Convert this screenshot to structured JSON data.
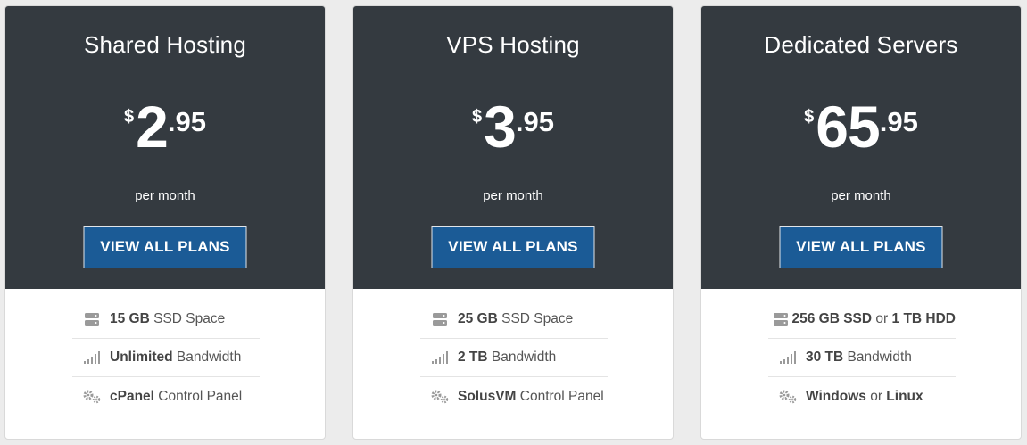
{
  "cards": [
    {
      "title": "Shared Hosting",
      "currency": "$",
      "price_whole": "2",
      "price_cents": ".95",
      "period": "per month",
      "button_label": "VIEW ALL PLANS",
      "features": [
        {
          "icon": "server-icon",
          "bold": "15 GB",
          "rest": " SSD Space",
          "bold2": "",
          "rest2": ""
        },
        {
          "icon": "signal-bars-icon",
          "bold": "Unlimited",
          "rest": " Bandwidth",
          "bold2": "",
          "rest2": ""
        },
        {
          "icon": "gears-icon",
          "bold": "cPanel",
          "rest": " Control Panel",
          "bold2": "",
          "rest2": ""
        }
      ]
    },
    {
      "title": "VPS Hosting",
      "currency": "$",
      "price_whole": "3",
      "price_cents": ".95",
      "period": "per month",
      "button_label": "VIEW ALL PLANS",
      "features": [
        {
          "icon": "server-icon",
          "bold": "25 GB",
          "rest": " SSD Space",
          "bold2": "",
          "rest2": ""
        },
        {
          "icon": "signal-bars-icon",
          "bold": "2 TB",
          "rest": " Bandwidth",
          "bold2": "",
          "rest2": ""
        },
        {
          "icon": "gears-icon",
          "bold": "SolusVM",
          "rest": " Control Panel",
          "bold2": "",
          "rest2": ""
        }
      ]
    },
    {
      "title": "Dedicated Servers",
      "currency": "$",
      "price_whole": "65",
      "price_cents": ".95",
      "period": "per month",
      "button_label": "VIEW ALL PLANS",
      "features": [
        {
          "icon": "server-icon",
          "bold": "256 GB SSD",
          "rest": " or ",
          "bold2": "1 TB HDD",
          "rest2": ""
        },
        {
          "icon": "signal-bars-icon",
          "bold": "30 TB",
          "rest": " Bandwidth",
          "bold2": "",
          "rest2": ""
        },
        {
          "icon": "gears-icon",
          "bold": "Windows",
          "rest": " or ",
          "bold2": "Linux",
          "rest2": ""
        }
      ]
    }
  ],
  "colors": {
    "card_header_bg": "#343a40",
    "button_bg": "#1b5b96",
    "page_bg": "#ececec",
    "icon_gray": "#9a9a9a"
  }
}
